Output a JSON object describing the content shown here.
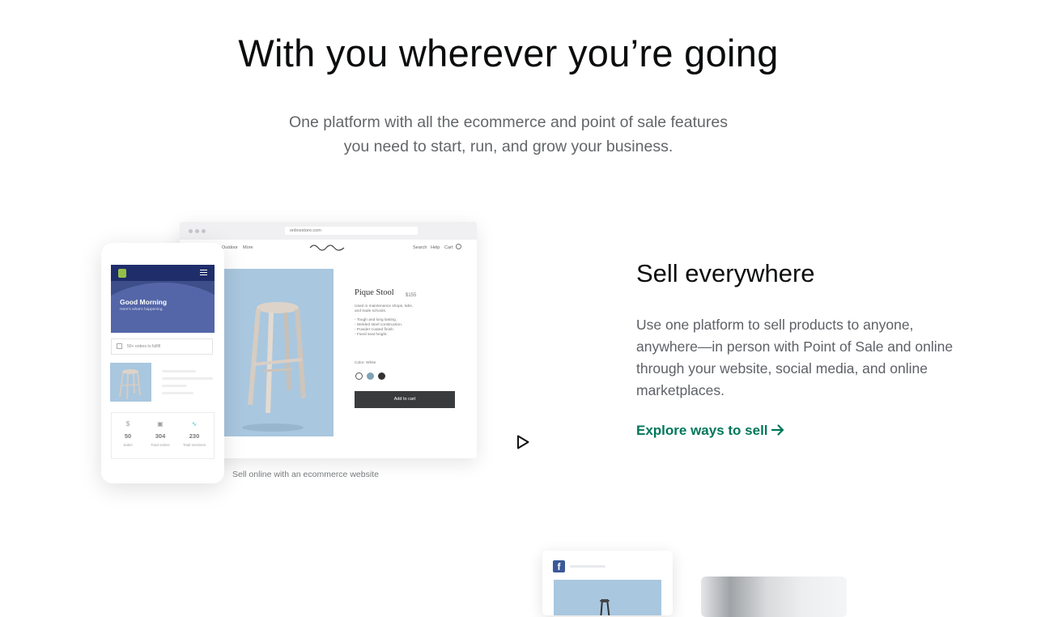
{
  "hero": {
    "title": "With you wherever you’re going",
    "subtitle_line1": "One platform with all the ecommerce and point of sale features",
    "subtitle_line2": "you need to start, run, and grow your business."
  },
  "mockup": {
    "browser": {
      "url": "onlinestore.com",
      "nav_left": [
        "Outdoor",
        "More"
      ],
      "nav_right": [
        "Search",
        "Help",
        "Cart"
      ],
      "product": {
        "title": "Pique Stool",
        "price": "$155",
        "desc_line1": "Used in maintenance shops, labs,",
        "desc_line2": "and trade schools.",
        "bullets": [
          "- Tough and long lasting.",
          "- Welded steel construction.",
          "- Powder-coated finish.",
          "- Fixed seat height."
        ],
        "color_label": "Color: White",
        "swatch_colors": [
          "#ffffff",
          "#7fa3b5",
          "#333333"
        ],
        "add_to_cart": "Add to cart"
      }
    },
    "phone": {
      "greeting": "Good Morning",
      "greeting_sub": "Here’s what’s happening.",
      "orders_text": "50+ orders to fulfill",
      "stats": [
        {
          "icon": "$",
          "value": "50",
          "label": "Sales"
        },
        {
          "icon": "▣",
          "value": "304",
          "label": "Total orders"
        },
        {
          "icon": "∿",
          "value": "230",
          "label": "Total sessions"
        }
      ]
    },
    "caption": "Sell online with an ecommerce website",
    "play_icon": "play-icon"
  },
  "section": {
    "title": "Sell everywhere",
    "body_line1": "Use one platform to sell products to anyone,",
    "body_line2": "anywhere—in person with Point of Sale and online",
    "body_line3": "through your website, social media, and online",
    "body_line4": "marketplaces.",
    "cta_label": "Explore ways to sell",
    "cta_color": "#00775a"
  },
  "teaser": {
    "facebook_glyph": "f",
    "facebook_color": "#3b5998"
  }
}
